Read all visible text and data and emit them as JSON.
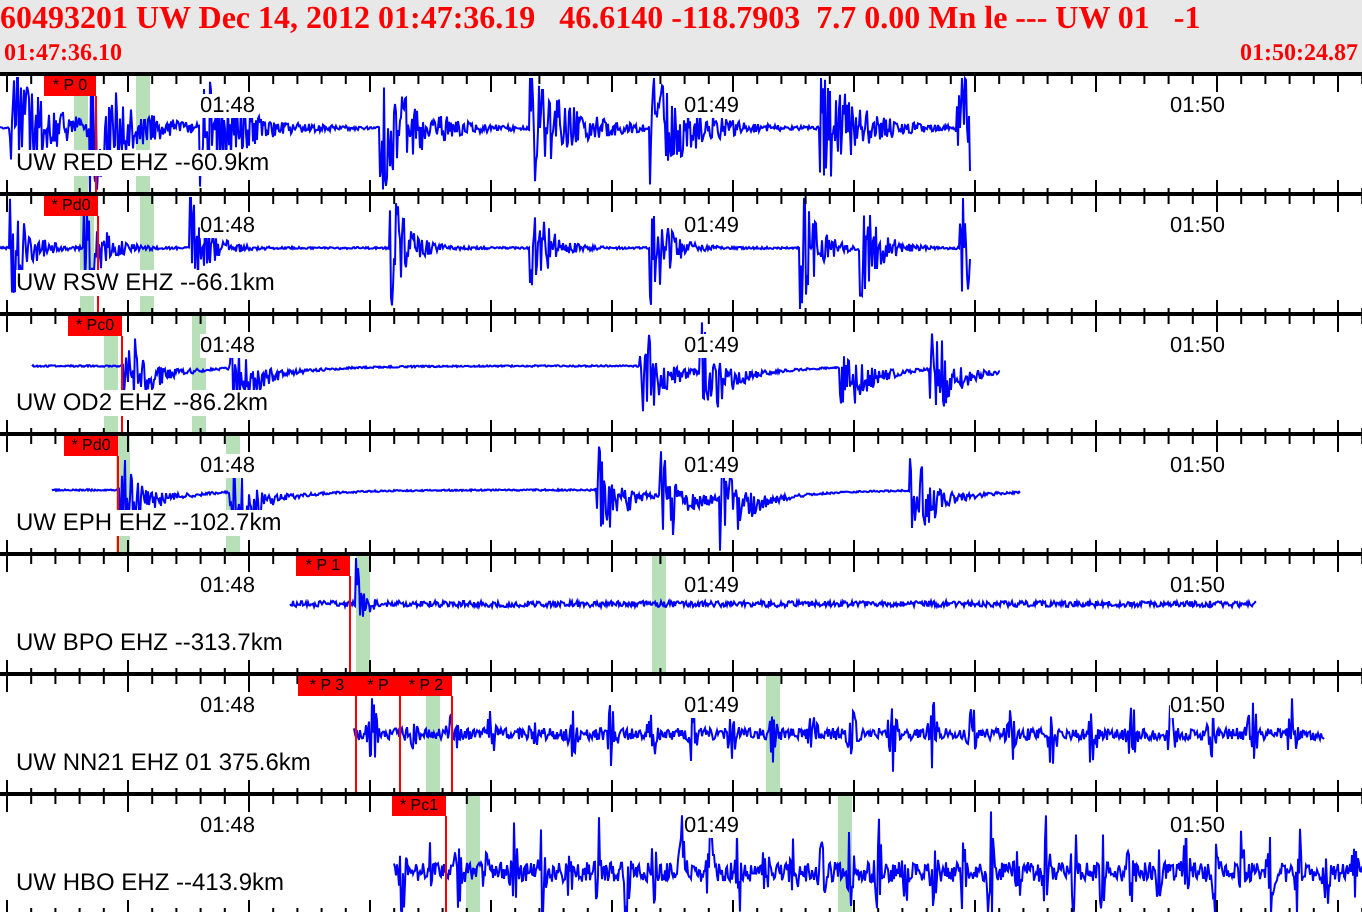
{
  "header": {
    "title": "60493201 UW Dec 14, 2012 01:47:36.19   46.6140 -118.7903  7.7 0.00 Mn le --- UW 01   -1",
    "start_time": "01:47:36.10",
    "end_time": "01:50:24.87"
  },
  "traces": [
    {
      "label": "UW RED EHZ --60.9km",
      "time_labels": [
        "01:48",
        "01:49",
        "01:50"
      ],
      "picks": [
        {
          "label": "* P 0"
        }
      ]
    },
    {
      "label": "UW RSW EHZ --66.1km",
      "time_labels": [
        "01:48",
        "01:49",
        "01:50"
      ],
      "picks": [
        {
          "label": "* Pd0"
        }
      ]
    },
    {
      "label": "UW OD2 EHZ --86.2km",
      "time_labels": [
        "01:48",
        "01:49",
        "01:50"
      ],
      "picks": [
        {
          "label": "* Pc0"
        }
      ]
    },
    {
      "label": "UW EPH EHZ --102.7km",
      "time_labels": [
        "01:48",
        "01:49",
        "01:50"
      ],
      "picks": [
        {
          "label": "* Pd0"
        }
      ]
    },
    {
      "label": "UW BPO EHZ --313.7km",
      "time_labels": [
        "01:48",
        "01:49",
        "01:50"
      ],
      "picks": [
        {
          "label": "* P 1"
        }
      ]
    },
    {
      "label": "UW NN21 EHZ 01 375.6km",
      "time_labels": [
        "01:48",
        "01:49",
        "01:50"
      ],
      "picks": [
        {
          "label": "* P 3"
        },
        {
          "label": "* P"
        },
        {
          "label": "* P 2"
        }
      ]
    },
    {
      "label": "UW HBO EHZ --413.9km",
      "time_labels": [
        "01:48",
        "01:49",
        "01:50"
      ],
      "picks": [
        {
          "label": "* Pc1"
        }
      ]
    }
  ]
}
